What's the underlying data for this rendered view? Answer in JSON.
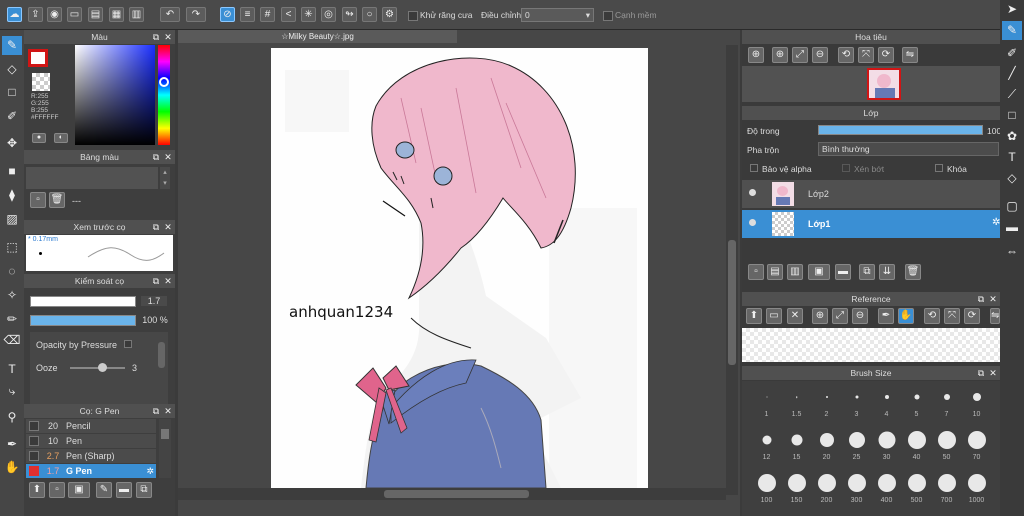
{
  "toolbar": {
    "antialias_label": "Khử răng cưa",
    "adjust_label": "Điều chỉnh",
    "adjust_value": "0",
    "edge_label": "Cạnh mềm"
  },
  "color_panel": {
    "title": "Màu",
    "r": "R:255",
    "g": "G:255",
    "b": "B:255",
    "hex": "#FFFFFF"
  },
  "palette_panel": {
    "title": "Bảng màu",
    "dash": "---"
  },
  "brush_preview": {
    "title": "Xem trước cọ",
    "size_text": "* 0.17mm"
  },
  "brush_control": {
    "title": "Kiểm soát cọ",
    "size_value": "1.7",
    "opacity_value": "100 %",
    "pressure_label": "Opacity by Pressure",
    "ooze_label": "Ooze",
    "ooze_value": "3"
  },
  "brush_list": {
    "title": "Cọ: G Pen",
    "items": [
      {
        "size": "20",
        "name": "Pencil"
      },
      {
        "size": "10",
        "name": "Pen"
      },
      {
        "size": "2.7",
        "name": "Pen (Sharp)"
      },
      {
        "size": "1.7",
        "name": "G Pen"
      }
    ]
  },
  "canvas": {
    "tab": "☆Milky Beauty☆.jpg",
    "watermark": "anhquan1234"
  },
  "navigator": {
    "title": "Hoa tiêu"
  },
  "layer_panel": {
    "title": "Lớp",
    "opacity_label": "Độ trong",
    "opacity_value": "100",
    "blend_label": "Pha trộn",
    "blend_value": "Bình thường",
    "protect_alpha": "Bảo vệ alpha",
    "clip": "Xén bớt",
    "lock": "Khóa",
    "layers": [
      {
        "name": "Lớp2"
      },
      {
        "name": "Lớp1"
      }
    ]
  },
  "reference_panel": {
    "title": "Reference"
  },
  "brush_size_panel": {
    "title": "Brush Size",
    "sizes": [
      "1",
      "1.5",
      "2",
      "3",
      "4",
      "5",
      "7",
      "10",
      "12",
      "15",
      "20",
      "25",
      "30",
      "40",
      "50",
      "70",
      "100",
      "150",
      "200",
      "300",
      "400",
      "500",
      "700",
      "1000"
    ]
  },
  "colors": {
    "accent": "#3a8fd4",
    "hair": "#f0b8cc",
    "uniform": "#6679b5",
    "ribbon": "#e0648c"
  }
}
